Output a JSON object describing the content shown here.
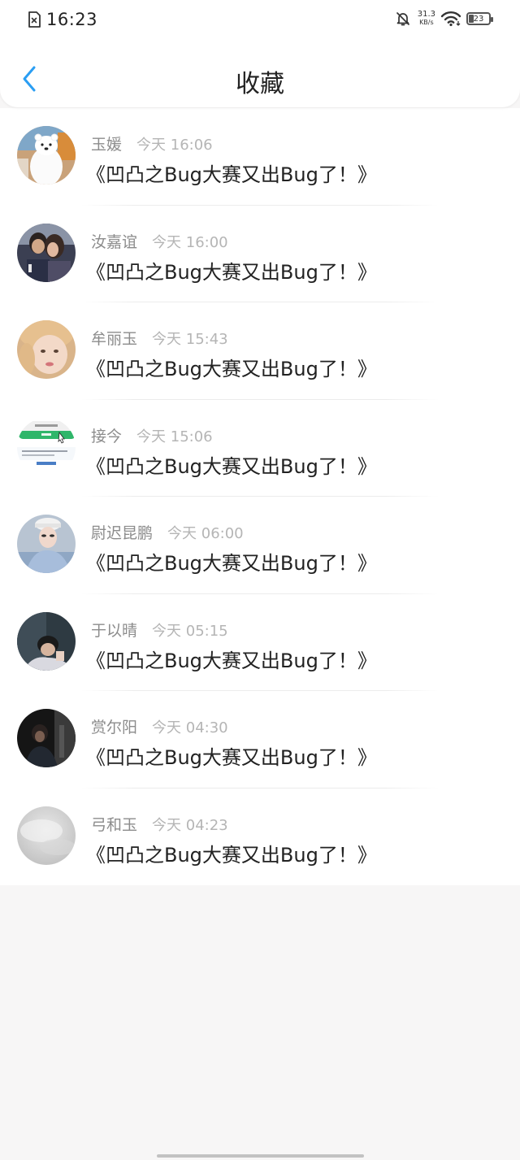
{
  "status_bar": {
    "time": "16:23",
    "net_speed_value": "31.3",
    "net_speed_unit": "KB/s",
    "battery": "23"
  },
  "header": {
    "title": "收藏"
  },
  "favorites": [
    {
      "name": "玉媛",
      "time": "今天 16:06",
      "message": "《凹凸之Bug大赛又出Bug了！》"
    },
    {
      "name": "汝嘉谊",
      "time": "今天 16:00",
      "message": "《凹凸之Bug大赛又出Bug了！》"
    },
    {
      "name": "牟丽玉",
      "time": "今天 15:43",
      "message": "《凹凸之Bug大赛又出Bug了！》"
    },
    {
      "name": "接今",
      "time": "今天 15:06",
      "message": "《凹凸之Bug大赛又出Bug了！》"
    },
    {
      "name": "尉迟昆鹏",
      "time": "今天 06:00",
      "message": "《凹凸之Bug大赛又出Bug了！》"
    },
    {
      "name": "于以晴",
      "time": "今天 05:15",
      "message": "《凹凸之Bug大赛又出Bug了！》"
    },
    {
      "name": "赏尔阳",
      "time": "今天 04:30",
      "message": "《凹凸之Bug大赛又出Bug了！》"
    },
    {
      "name": "弓和玉",
      "time": "今天 04:23",
      "message": "《凹凸之Bug大赛又出Bug了！》"
    }
  ],
  "colors": {
    "accent": "#2a9ef3",
    "background": "#f7f6f6",
    "name_text": "#8c8c8c",
    "time_text": "#b5b5b5"
  }
}
